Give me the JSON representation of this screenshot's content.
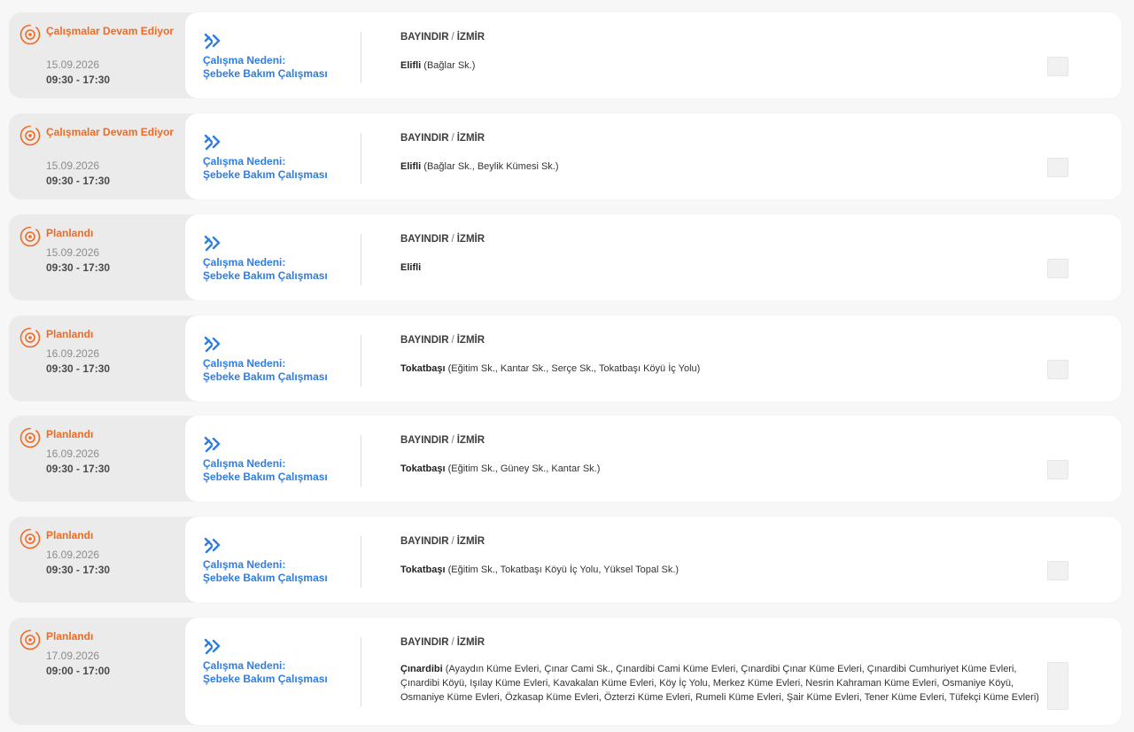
{
  "colors": {
    "status": "#f26a21",
    "reason": "#2f7de1"
  },
  "icons": {
    "status": "gear-progress-icon",
    "work": "tools-icon"
  },
  "items": [
    {
      "status": "Çalışmalar Devam Ediyor",
      "date": "15.09.2026",
      "time": "09:30 - 17:30",
      "reason_label": "Çalışma Nedeni:",
      "reason": "Şebeke Bakım Çalışması",
      "district": "BAYINDIR",
      "separator": "/",
      "city": "İZMİR",
      "neighborhood": "Elifli",
      "streets": "(Bağlar Sk.)"
    },
    {
      "status": "Çalışmalar Devam Ediyor",
      "date": "15.09.2026",
      "time": "09:30 - 17:30",
      "reason_label": "Çalışma Nedeni:",
      "reason": "Şebeke Bakım Çalışması",
      "district": "BAYINDIR",
      "separator": "/",
      "city": "İZMİR",
      "neighborhood": "Elifli",
      "streets": "(Bağlar Sk., Beylik Kümesi Sk.)"
    },
    {
      "status": "Planlandı",
      "date": "15.09.2026",
      "time": "09:30 - 17:30",
      "reason_label": "Çalışma Nedeni:",
      "reason": "Şebeke Bakım Çalışması",
      "district": "BAYINDIR",
      "separator": "/",
      "city": "İZMİR",
      "neighborhood": "Elifli",
      "streets": ""
    },
    {
      "status": "Planlandı",
      "date": "16.09.2026",
      "time": "09:30 - 17:30",
      "reason_label": "Çalışma Nedeni:",
      "reason": "Şebeke Bakım Çalışması",
      "district": "BAYINDIR",
      "separator": "/",
      "city": "İZMİR",
      "neighborhood": "Tokatbaşı",
      "streets": "(Eğitim Sk., Kantar Sk., Serçe Sk., Tokatbaşı Köyü İç Yolu)"
    },
    {
      "status": "Planlandı",
      "date": "16.09.2026",
      "time": "09:30 - 17:30",
      "reason_label": "Çalışma Nedeni:",
      "reason": "Şebeke Bakım Çalışması",
      "district": "BAYINDIR",
      "separator": "/",
      "city": "İZMİR",
      "neighborhood": "Tokatbaşı",
      "streets": "(Eğitim Sk., Güney Sk., Kantar Sk.)"
    },
    {
      "status": "Planlandı",
      "date": "16.09.2026",
      "time": "09:30 - 17:30",
      "reason_label": "Çalışma Nedeni:",
      "reason": "Şebeke Bakım Çalışması",
      "district": "BAYINDIR",
      "separator": "/",
      "city": "İZMİR",
      "neighborhood": "Tokatbaşı",
      "streets": "(Eğitim Sk., Tokatbaşı Köyü İç Yolu, Yüksel Topal Sk.)"
    },
    {
      "status": "Planlandı",
      "date": "17.09.2026",
      "time": "09:00 - 17:00",
      "reason_label": "Çalışma Nedeni:",
      "reason": "Şebeke Bakım Çalışması",
      "district": "BAYINDIR",
      "separator": "/",
      "city": "İZMİR",
      "neighborhood": "Çınardibi",
      "streets": "(Ayaydın Küme Evleri, Çınar Cami Sk., Çınardibi Cami Küme Evleri, Çınardibi Çınar Küme Evleri, Çınardibi Cumhuriyet Küme Evleri, Çınardibi Köyü, Işılay Küme Evleri, Kavakalan Küme Evleri, Köy İç Yolu, Merkez Küme Evleri, Nesrin Kahraman Küme Evleri, Osmaniye Köyü, Osmaniye Küme Evleri, Özkasap Küme Evleri, Özterzi Küme Evleri, Rumeli Küme Evleri, Şair Küme Evleri, Tener Küme Evleri, Tüfekçi Küme Evleri)"
    }
  ]
}
